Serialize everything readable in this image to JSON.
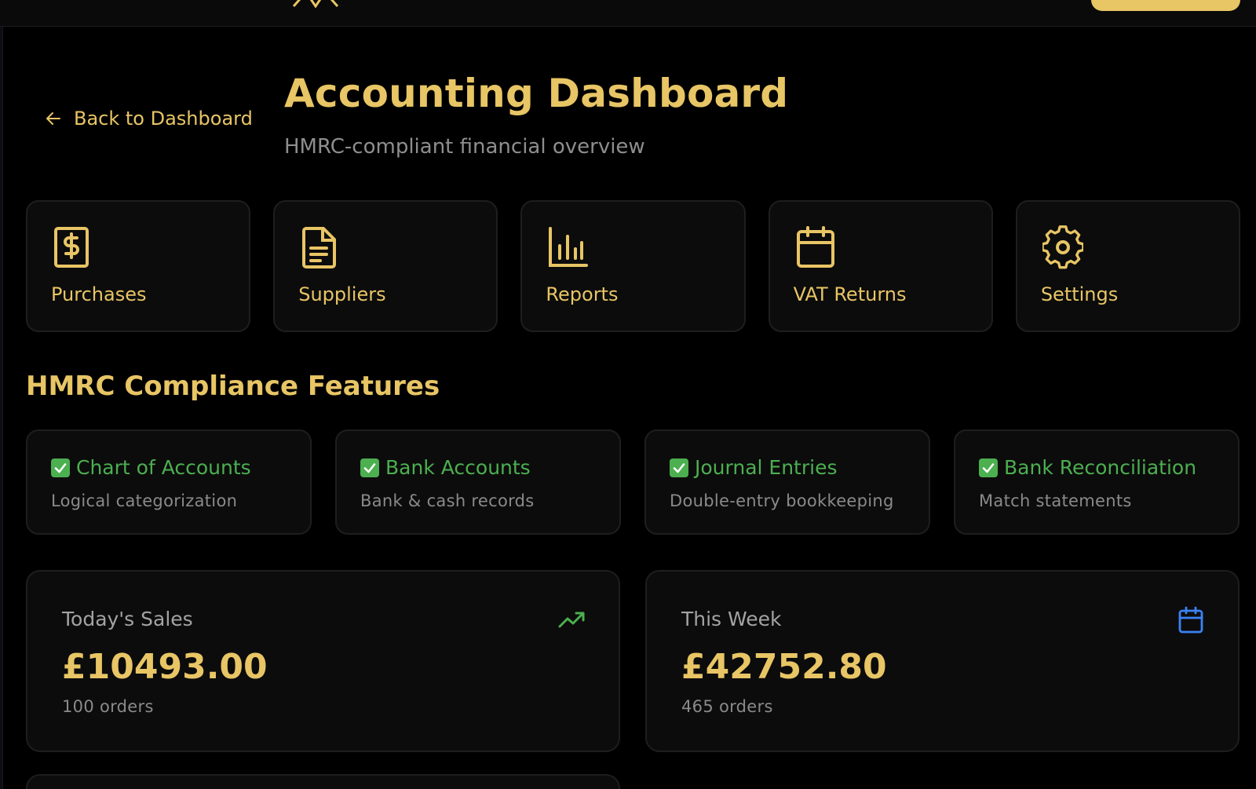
{
  "header": {
    "back_label": "Back to Dashboard",
    "title": "Accounting Dashboard",
    "subtitle": "HMRC-compliant financial overview"
  },
  "nav_tiles": [
    {
      "label": "Purchases",
      "icon": "receipt-dollar-icon"
    },
    {
      "label": "Suppliers",
      "icon": "document-icon"
    },
    {
      "label": "Reports",
      "icon": "bar-chart-icon"
    },
    {
      "label": "VAT Returns",
      "icon": "calendar-icon"
    },
    {
      "label": "Settings",
      "icon": "gear-icon"
    }
  ],
  "compliance": {
    "title": "HMRC Compliance Features",
    "features": [
      {
        "title": "Chart of Accounts",
        "desc": "Logical categorization"
      },
      {
        "title": "Bank Accounts",
        "desc": "Bank & cash records"
      },
      {
        "title": "Journal Entries",
        "desc": "Double-entry bookkeeping"
      },
      {
        "title": "Bank Reconciliation",
        "desc": "Match statements"
      }
    ]
  },
  "stats": [
    {
      "label": "Today's Sales",
      "value": "£10493.00",
      "sub": "100 orders",
      "icon": "trending-up-icon",
      "icon_color": "#4caf50"
    },
    {
      "label": "This Week",
      "value": "£42752.80",
      "sub": "465 orders",
      "icon": "calendar-icon",
      "icon_color": "#3b82f6"
    }
  ],
  "colors": {
    "background": "#000000",
    "card": "#0c0c0c",
    "accent_gold": "#e8c565",
    "success_green": "#4caf50",
    "muted_text": "#8a8a8a"
  }
}
